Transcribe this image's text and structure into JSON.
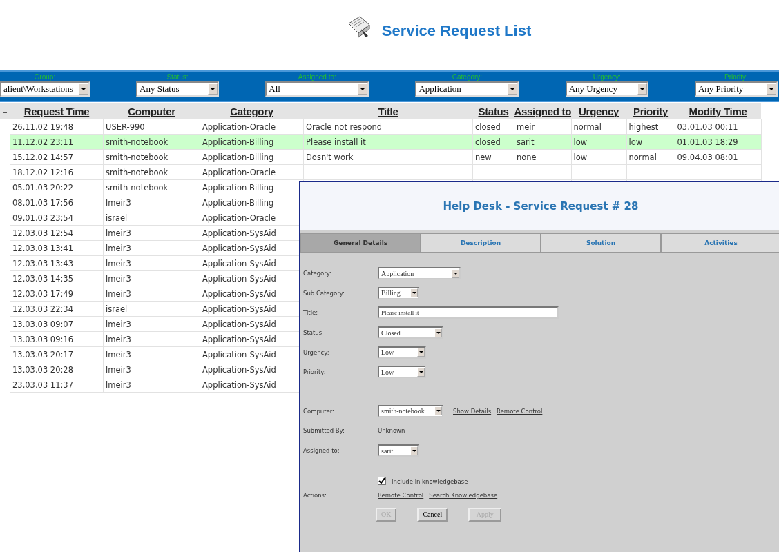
{
  "page": {
    "title": "Service Request List"
  },
  "filters": [
    {
      "label": "Group:",
      "value": "alient\\Workstations"
    },
    {
      "label": "Status:",
      "value": "Any Status"
    },
    {
      "label": "Assigned to:",
      "value": "All"
    },
    {
      "label": "Category:",
      "value": "Application"
    },
    {
      "label": "Urgency:",
      "value": "Any Urgency"
    },
    {
      "label": "Priority:",
      "value": "Any Priority"
    }
  ],
  "table": {
    "columns": [
      "Request Time",
      "Computer",
      "Category",
      "Title",
      "Status",
      "Assigned to",
      "Urgency",
      "Priority",
      "Modify Time"
    ],
    "rows": [
      {
        "selected": false,
        "cells": [
          "26.11.02 19:48",
          "USER-990",
          "Application-Oracle",
          "Oracle not respond",
          "closed",
          "meir",
          "normal",
          "highest",
          "03.01.03 00:11"
        ]
      },
      {
        "selected": true,
        "cells": [
          "11.12.02 23:11",
          "smith-notebook",
          "Application-Billing",
          "Please install it",
          "closed",
          "sarit",
          "low",
          "low",
          "01.01.03 18:29"
        ]
      },
      {
        "selected": false,
        "cells": [
          "15.12.02 14:57",
          "smith-notebook",
          "Application-Billing",
          "Dosn't work",
          "new",
          "none",
          "low",
          "normal",
          "09.04.03 08:01"
        ]
      },
      {
        "selected": false,
        "cells": [
          "18.12.02 12:16",
          "smith-notebook",
          "Application-Oracle"
        ]
      },
      {
        "selected": false,
        "cells": [
          "05.01.03 20:22",
          "smith-notebook",
          "Application-Billing"
        ]
      },
      {
        "selected": false,
        "cells": [
          "08.01.03 17:56",
          "lmeir3",
          "Application-Billing"
        ]
      },
      {
        "selected": false,
        "cells": [
          "09.01.03 23:54",
          "israel",
          "Application-Oracle"
        ]
      },
      {
        "selected": false,
        "cells": [
          "12.03.03 12:54",
          "lmeir3",
          "Application-SysAid"
        ]
      },
      {
        "selected": false,
        "cells": [
          "12.03.03 13:41",
          "lmeir3",
          "Application-SysAid"
        ]
      },
      {
        "selected": false,
        "cells": [
          "12.03.03 13:43",
          "lmeir3",
          "Application-SysAid"
        ]
      },
      {
        "selected": false,
        "cells": [
          "12.03.03 14:35",
          "lmeir3",
          "Application-SysAid"
        ]
      },
      {
        "selected": false,
        "cells": [
          "12.03.03 17:49",
          "lmeir3",
          "Application-SysAid"
        ]
      },
      {
        "selected": false,
        "cells": [
          "12.03.03 22:34",
          "israel",
          "Application-SysAid"
        ]
      },
      {
        "selected": false,
        "cells": [
          "13.03.03 09:07",
          "lmeir3",
          "Application-SysAid"
        ]
      },
      {
        "selected": false,
        "cells": [
          "13.03.03 09:16",
          "lmeir3",
          "Application-SysAid"
        ]
      },
      {
        "selected": false,
        "cells": [
          "13.03.03 20:17",
          "lmeir3",
          "Application-SysAid"
        ]
      },
      {
        "selected": false,
        "cells": [
          "13.03.03 20:28",
          "lmeir3",
          "Application-SysAid"
        ]
      },
      {
        "selected": false,
        "cells": [
          "23.03.03 11:37",
          "lmeir3",
          "Application-SysAid"
        ]
      }
    ]
  },
  "dialog": {
    "title": "Help Desk - Service Request # 28",
    "tabs": [
      {
        "label": "General Details",
        "selected": true
      },
      {
        "label": "Description",
        "selected": false
      },
      {
        "label": "Solution",
        "selected": false
      },
      {
        "label": "Activities",
        "selected": false
      }
    ],
    "fields": [
      {
        "kind": "select",
        "label": "Category:",
        "value": "Application"
      },
      {
        "kind": "select",
        "label": "Sub Category:",
        "value": "Billing"
      },
      {
        "kind": "text",
        "label": "Title:",
        "value": "Please install it"
      },
      {
        "kind": "select",
        "label": "Status:",
        "value": "Closed"
      },
      {
        "kind": "select",
        "label": "Urgency:",
        "value": "Low"
      },
      {
        "kind": "select",
        "label": "Priority:",
        "value": "Low"
      },
      {
        "kind": "gap"
      },
      {
        "kind": "select",
        "label": "Computer:",
        "value": "smith-notebook",
        "links": [
          "Show Details",
          "Remote Control"
        ]
      },
      {
        "kind": "plain",
        "label": "Submitted By:",
        "value": "Unknown"
      },
      {
        "kind": "select",
        "label": "Assigned to:",
        "value": "sarit"
      },
      {
        "kind": "checkbox",
        "label": "Include in knowledgebase",
        "checked": true
      },
      {
        "kind": "actions",
        "label": "Actions:",
        "links": [
          "Remote Control",
          "Search Knowledgebase"
        ]
      }
    ],
    "buttons": [
      {
        "label": "OK",
        "disabled": true
      },
      {
        "label": "Cancel",
        "disabled": false
      },
      {
        "label": "Apply",
        "disabled": true
      }
    ]
  }
}
